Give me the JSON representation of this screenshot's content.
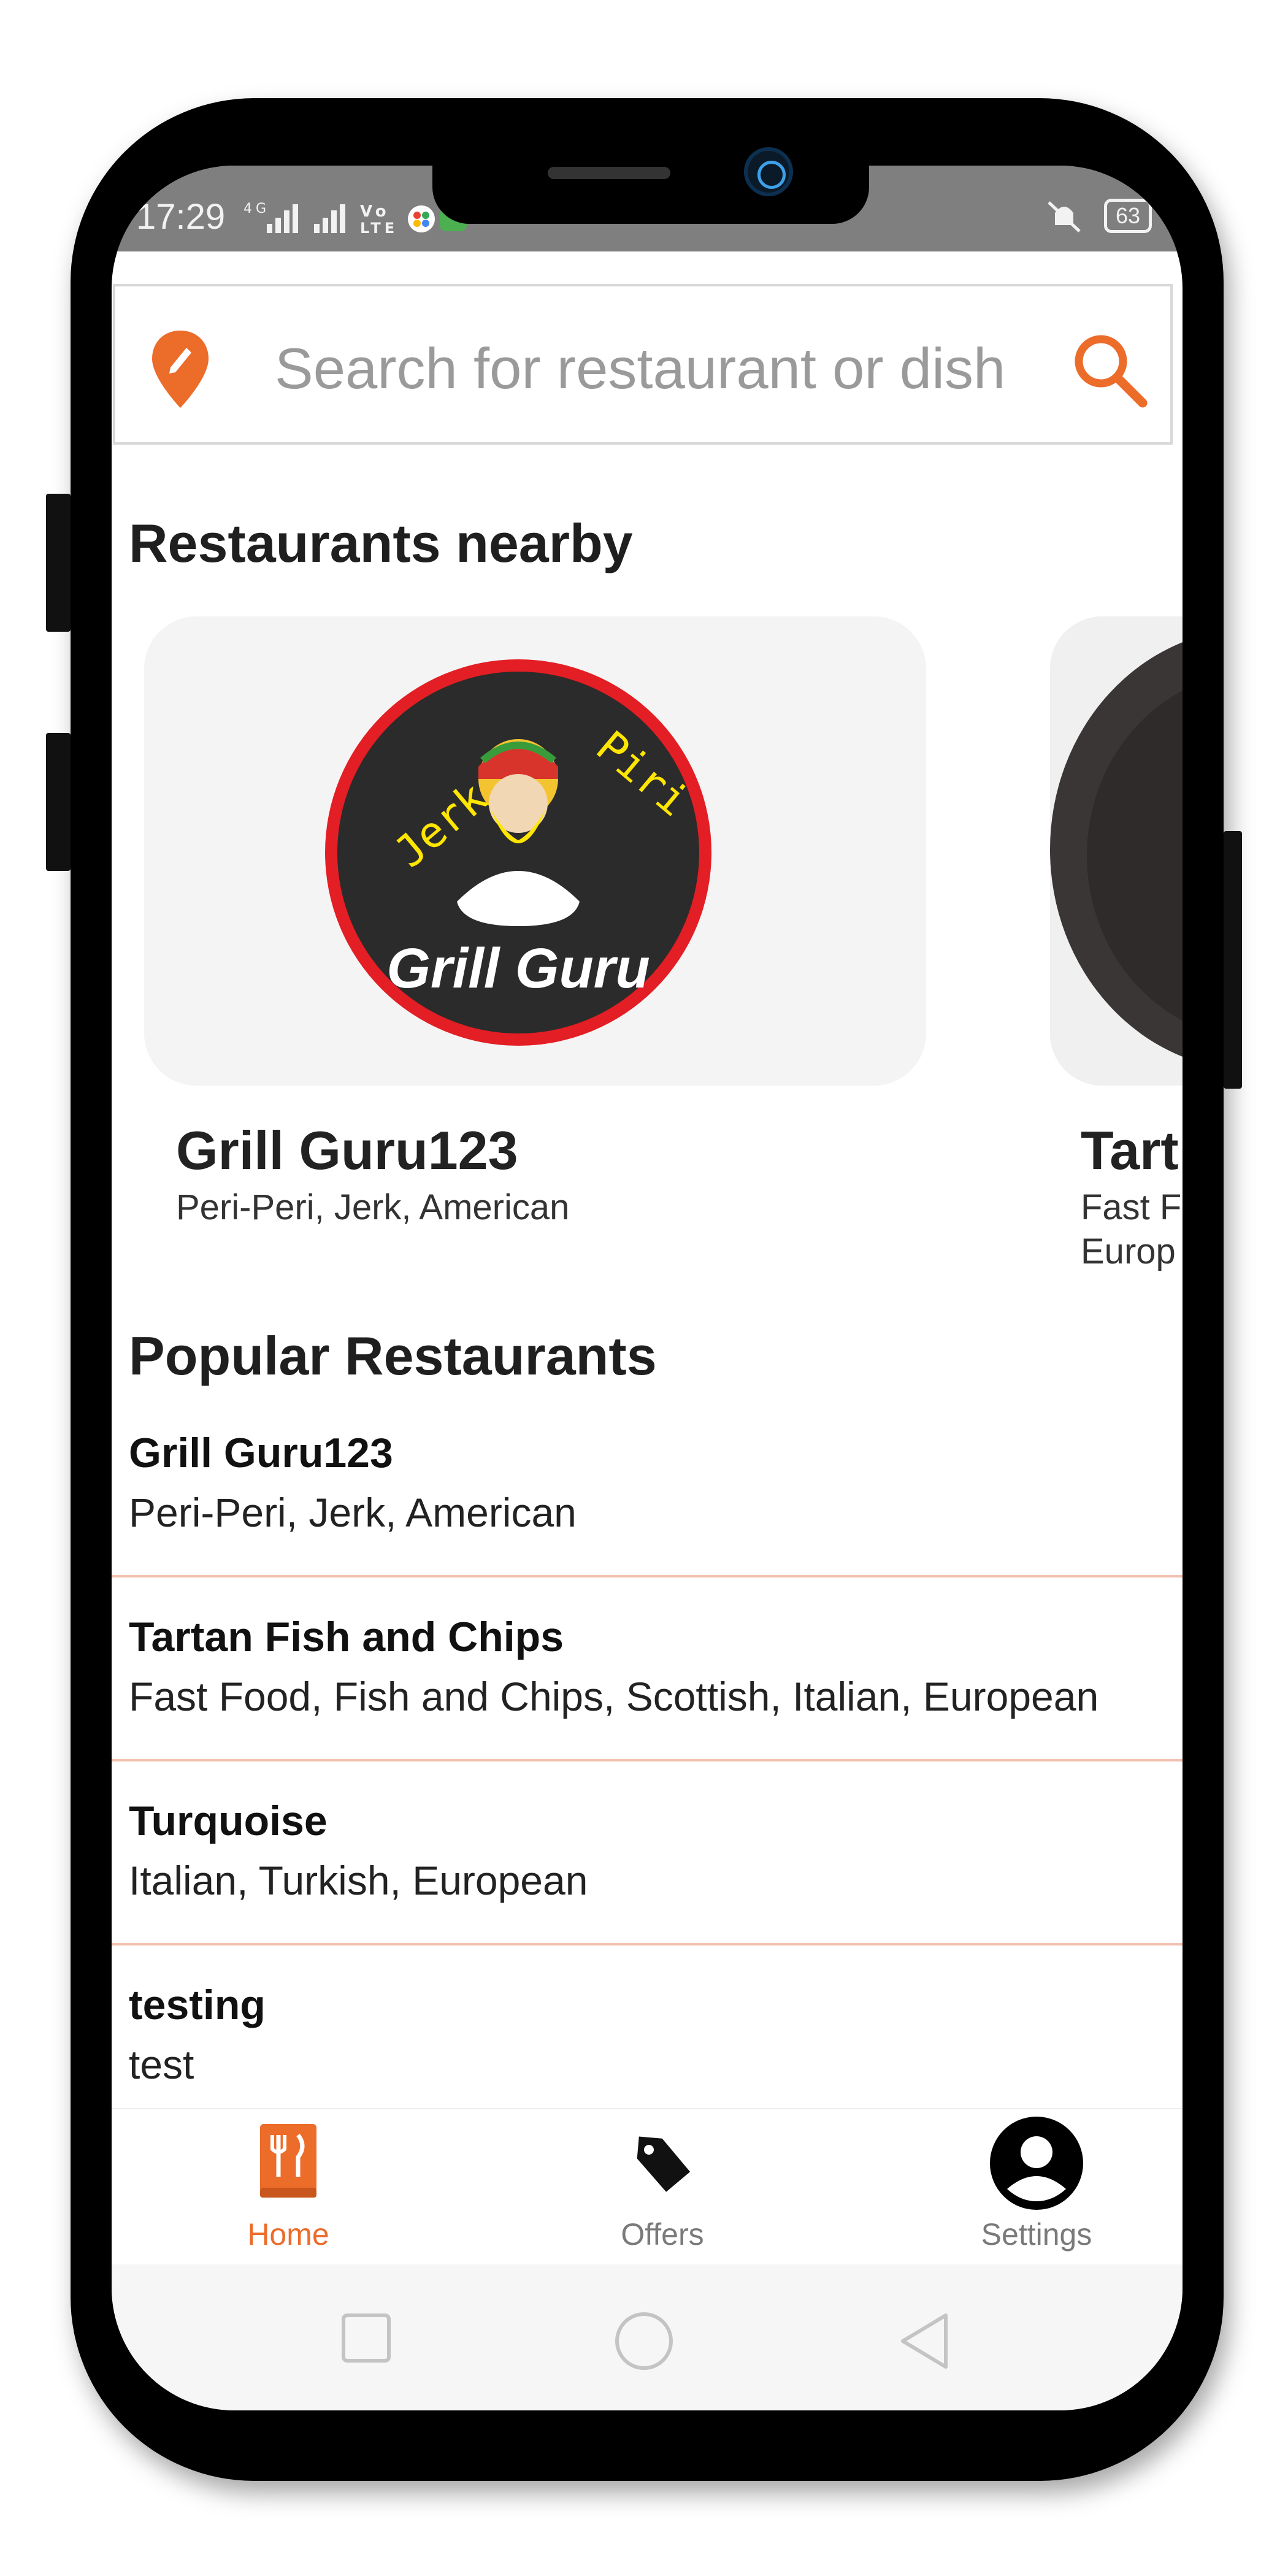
{
  "status_bar": {
    "time": "17:29",
    "signal_text": "4G  ▮▮▮ ▮▮▮ Vo LTE",
    "battery": "63"
  },
  "search": {
    "placeholder": "Search for restaurant or dish"
  },
  "nearby": {
    "title": "Restaurants nearby",
    "cards": [
      {
        "name": "Grill Guru123",
        "cuisine": "Peri-Peri, Jerk, American",
        "logo_top": "Jerk Piri",
        "logo_bottom": "Grill Guru"
      },
      {
        "name": "Tart",
        "cuisine_line1": "Fast F",
        "cuisine_line2": "Europ"
      }
    ]
  },
  "popular": {
    "title": "Popular Restaurants",
    "items": [
      {
        "name": "Grill Guru123",
        "cuisine": "Peri-Peri, Jerk, American"
      },
      {
        "name": "Tartan Fish and Chips",
        "cuisine": "Fast Food, Fish and Chips, Scottish, Italian, European"
      },
      {
        "name": "Turquoise",
        "cuisine": "Italian, Turkish, European"
      },
      {
        "name": "testing",
        "cuisine": "test"
      }
    ]
  },
  "bottom_nav": {
    "home": "Home",
    "offers": "Offers",
    "settings": "Settings"
  },
  "colors": {
    "accent": "#ec6c2a",
    "divider": "#f1c2b0",
    "status_bar": "#7f7f7f"
  }
}
